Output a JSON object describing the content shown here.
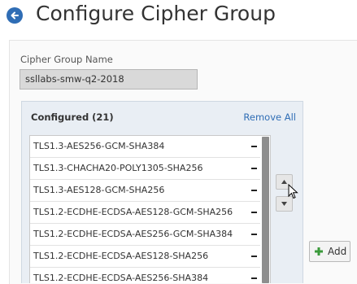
{
  "header": {
    "title": "Configure Cipher Group",
    "back_icon": "back-arrow-icon",
    "accent": "#2f6db5"
  },
  "form": {
    "name_label": "Cipher Group Name",
    "name_value": "ssllabs-smw-q2-2018"
  },
  "configured": {
    "title": "Configured (21)",
    "remove_all_label": "Remove All",
    "items": [
      {
        "label": "TLS1.3-AES256-GCM-SHA384"
      },
      {
        "label": "TLS1.3-CHACHA20-POLY1305-SHA256"
      },
      {
        "label": "TLS1.3-AES128-GCM-SHA256"
      },
      {
        "label": "TLS1.2-ECDHE-ECDSA-AES128-GCM-SHA256"
      },
      {
        "label": "TLS1.2-ECDHE-ECDSA-AES256-GCM-SHA384"
      },
      {
        "label": "TLS1.2-ECDHE-ECDSA-AES128-SHA256"
      },
      {
        "label": "TLS1.2-ECDHE-ECDSA-AES256-SHA384"
      }
    ]
  },
  "actions": {
    "add_label": "Add",
    "move_up_icon": "triangle-up-icon",
    "move_down_icon": "triangle-down-icon"
  }
}
